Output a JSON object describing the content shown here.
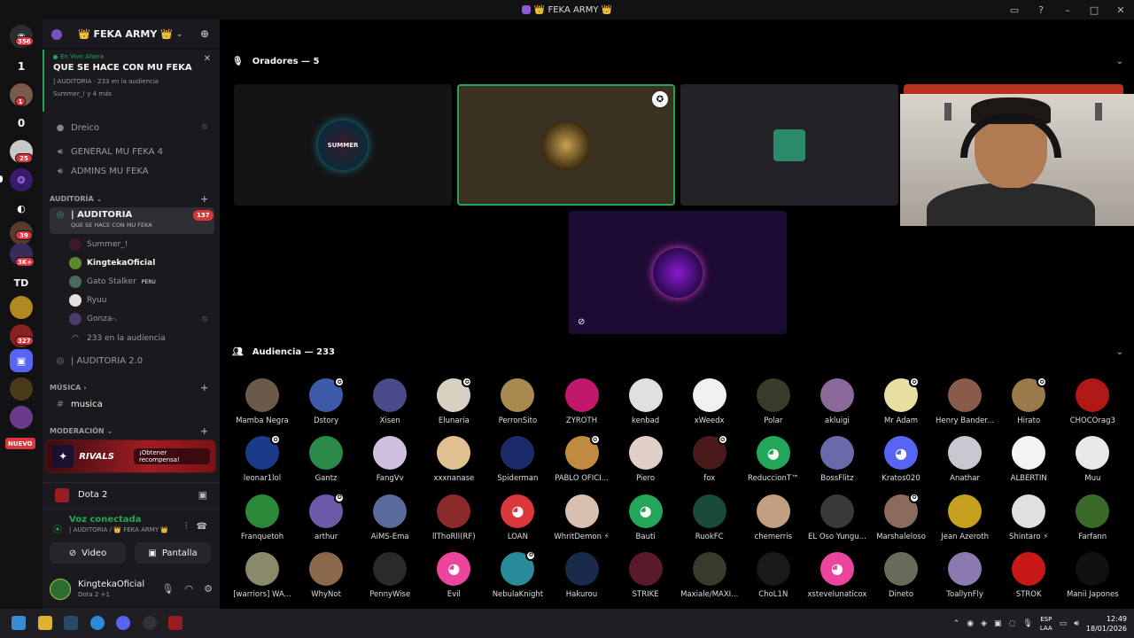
{
  "window": {
    "title": "👑 FEKA ARMY 👑"
  },
  "rail": {
    "badges": [
      "356",
      "1",
      "25",
      "39",
      "3K+",
      "327"
    ],
    "labels": [
      "1",
      "0",
      "TD"
    ],
    "new_label": "NUEVO"
  },
  "server": {
    "name": "👑 FEKA ARMY 👑"
  },
  "live": {
    "tag": "En Vivo Ahora",
    "title": "QUE SE HACE CON MU FEKA",
    "meta": "| AUDITORIA · 233 en la audiencia",
    "users": "Summer_! y 4 más"
  },
  "channels": {
    "dreico": "Dreico",
    "general": "GENERAL MU FEKA 4",
    "admins": "ADMINS MU FEKA",
    "cat_auditoria": "AUDITORÍA",
    "auditoria": "| AUDITORIA",
    "auditoria_count": "137",
    "auditoria_sub": "QUE SE HACE CON MU FEKA",
    "members": [
      "Summer_!",
      "KingtekaOficial",
      "Gato Stalker",
      "Ryuu",
      "Gonza-."
    ],
    "gato_tag": "PERU",
    "audience_count": "233 en la audiencia",
    "auditoria2": "| AUDITORIA 2.0",
    "cat_musica": "MÚSICA",
    "musica": "musica",
    "cat_moderacion": "MODERACIÓN"
  },
  "promo": {
    "logo": "RIVALS",
    "button": "¡Obtener recompensa!"
  },
  "game": {
    "name": "Dota 2"
  },
  "voice": {
    "status": "Voz conectada",
    "location": "| AUDITORIA / 👑 FEKA ARMY 👑",
    "video_label": "Video",
    "screen_label": "Pantalla"
  },
  "user": {
    "name": "KingtekaOficial",
    "status": "Dota 2 +1"
  },
  "stage": {
    "speakers_title": "Oradores — 5",
    "audience_title": "Audiencia — 233",
    "speaker_logo_text": "SUMMER"
  },
  "audience": [
    {
      "name": "Mamba Negra",
      "color": "#6b5a4a",
      "mark": false,
      "dc": false
    },
    {
      "name": "Dstory",
      "color": "#3c5aa8",
      "mark": true,
      "dc": false
    },
    {
      "name": "Xisen",
      "color": "#4a4a8a",
      "mark": false,
      "dc": false
    },
    {
      "name": "Elunaria",
      "color": "#d8d0c0",
      "mark": true,
      "dc": false
    },
    {
      "name": "PerronSito",
      "color": "#a88a50",
      "mark": false,
      "dc": false
    },
    {
      "name": "ZYROTH",
      "color": "#c2186b",
      "mark": false,
      "dc": false
    },
    {
      "name": "kenbad",
      "color": "#e0e0e0",
      "mark": false,
      "dc": false
    },
    {
      "name": "xWeedx",
      "color": "#f0f0f0",
      "mark": false,
      "dc": false
    },
    {
      "name": "Polar",
      "color": "#3a3a2a",
      "mark": false,
      "dc": false
    },
    {
      "name": "akluigi",
      "color": "#8a6a9a",
      "mark": false,
      "dc": false
    },
    {
      "name": "Mr Adam",
      "color": "#e8e0a0",
      "mark": true,
      "dc": false
    },
    {
      "name": "Henry Bander...",
      "color": "#8a5a4a",
      "mark": false,
      "dc": false
    },
    {
      "name": "Hirato",
      "color": "#9a7a4a",
      "mark": true,
      "dc": false
    },
    {
      "name": "CHOCOrag3",
      "color": "#b01818",
      "mark": false,
      "dc": false
    },
    {
      "name": "leonar1lol",
      "color": "#1a3a8a",
      "mark": true,
      "dc": false
    },
    {
      "name": "Gantz",
      "color": "#2a8a4a",
      "mark": false,
      "dc": false
    },
    {
      "name": "FangVv",
      "color": "#d0c0e0",
      "mark": false,
      "dc": false
    },
    {
      "name": "xxxnanase",
      "color": "#e0c090",
      "mark": false,
      "dc": false
    },
    {
      "name": "Spiderman",
      "color": "#1a2a6a",
      "mark": false,
      "dc": false
    },
    {
      "name": "PABLO OFICI...",
      "color": "#c08a40",
      "mark": true,
      "dc": false
    },
    {
      "name": "Piero",
      "color": "#e0d0c8",
      "mark": false,
      "dc": false
    },
    {
      "name": "fox",
      "color": "#4a1a1a",
      "mark": true,
      "dc": false
    },
    {
      "name": "ReduccionT™",
      "color": "#23a55a",
      "mark": false,
      "dc": true
    },
    {
      "name": "BossFlitz",
      "color": "#6a6aaa",
      "mark": false,
      "dc": false
    },
    {
      "name": "Kratos020",
      "color": "#5865f2",
      "mark": false,
      "dc": true
    },
    {
      "name": "Anathar",
      "color": "#c8c8d0",
      "mark": false,
      "dc": false
    },
    {
      "name": "ALBERTIN",
      "color": "#f4f4f4",
      "mark": false,
      "dc": false
    },
    {
      "name": "Muu",
      "color": "#e8e8e8",
      "mark": false,
      "dc": false
    },
    {
      "name": "Franquetoh",
      "color": "#2a8a3a",
      "mark": false,
      "dc": false
    },
    {
      "name": "arthur",
      "color": "#6a5aa8",
      "mark": true,
      "dc": false
    },
    {
      "name": "AiMS-Ema",
      "color": "#5a6a9a",
      "mark": false,
      "dc": false
    },
    {
      "name": "llThoRll(RF)",
      "color": "#8a2a2a",
      "mark": false,
      "dc": false
    },
    {
      "name": "LOAN",
      "color": "#da373c",
      "mark": false,
      "dc": true
    },
    {
      "name": "WhritDemon ⚡",
      "color": "#d8c0b0",
      "mark": false,
      "dc": false
    },
    {
      "name": "Bauti",
      "color": "#23a55a",
      "mark": false,
      "dc": true
    },
    {
      "name": "RuokFC",
      "color": "#1a4a3a",
      "mark": false,
      "dc": false
    },
    {
      "name": "chemerris",
      "color": "#c0a080",
      "mark": false,
      "dc": false
    },
    {
      "name": "EL Oso Yungu...",
      "color": "#3a3a3a",
      "mark": false,
      "dc": false
    },
    {
      "name": "Marshaleloso",
      "color": "#8a6a5a",
      "mark": true,
      "dc": false
    },
    {
      "name": "Jean Azeroth",
      "color": "#c8a020",
      "mark": false,
      "dc": false
    },
    {
      "name": "Shintaro ⚡",
      "color": "#e0e0e0",
      "mark": false,
      "dc": false
    },
    {
      "name": "Farfann",
      "color": "#3a6a2a",
      "mark": false,
      "dc": false
    },
    {
      "name": "[warriors] WA...",
      "color": "#8a8a6a",
      "mark": false,
      "dc": false
    },
    {
      "name": "WhyNot",
      "color": "#8a6a4a",
      "mark": false,
      "dc": false
    },
    {
      "name": "PennyWise",
      "color": "#2a2a2a",
      "mark": false,
      "dc": false
    },
    {
      "name": "Evil",
      "color": "#eb459e",
      "mark": false,
      "dc": true
    },
    {
      "name": "NebulaKnight",
      "color": "#2a8a9a",
      "mark": true,
      "dc": false
    },
    {
      "name": "Hakurou",
      "color": "#1a2a4a",
      "mark": false,
      "dc": false
    },
    {
      "name": "STRIKE",
      "color": "#5a1a2a",
      "mark": false,
      "dc": false
    },
    {
      "name": "Maxiale/MAXI...",
      "color": "#3a3a2a",
      "mark": false,
      "dc": false
    },
    {
      "name": "ChoL1N",
      "color": "#1a1a1a",
      "mark": false,
      "dc": false
    },
    {
      "name": "xstevelunaticox",
      "color": "#eb459e",
      "mark": false,
      "dc": true
    },
    {
      "name": "Dineto",
      "color": "#6a6a5a",
      "mark": false,
      "dc": false
    },
    {
      "name": "ToallynFly",
      "color": "#8a7ab0",
      "mark": false,
      "dc": false
    },
    {
      "name": "STROK",
      "color": "#c81818",
      "mark": false,
      "dc": false
    },
    {
      "name": "Manii Japones",
      "color": "#111111",
      "mark": false,
      "dc": false
    }
  ],
  "tray": {
    "lang1": "ESP",
    "lang2": "LAA",
    "time": "12:49",
    "date": "18/01/2026"
  }
}
